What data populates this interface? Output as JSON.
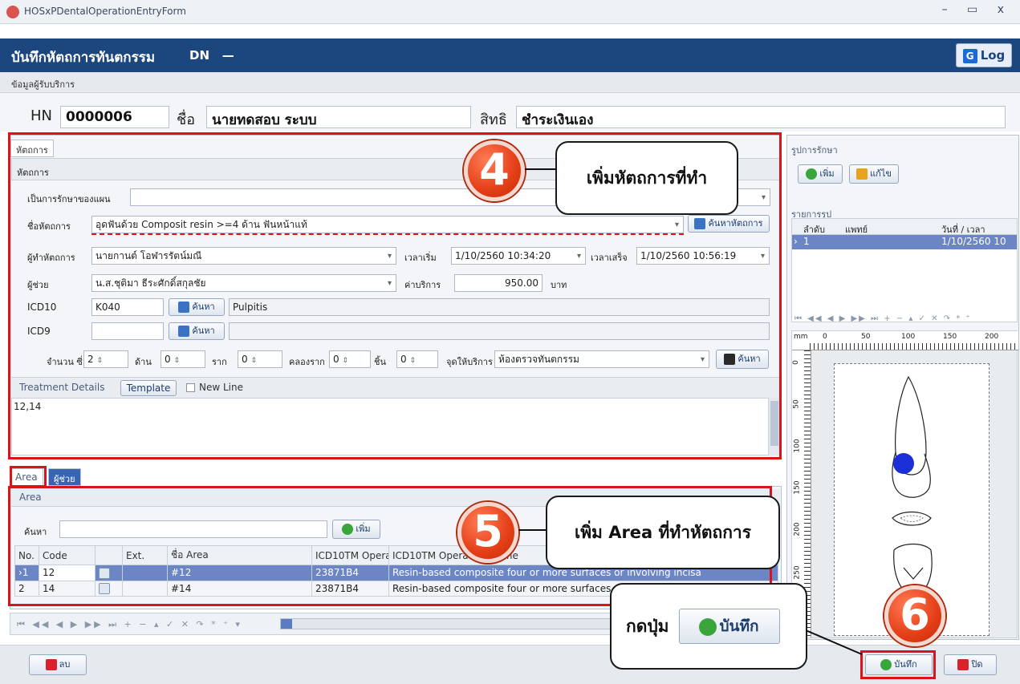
{
  "window": {
    "title": "HOSxPDentalOperationEntryForm",
    "controls": "–   ▭   x"
  },
  "header": {
    "title": "บันทึกหัตถการทันตกรรม",
    "dn": "DN",
    "dn_value": "—",
    "log_label": "Log",
    "log_icon": "log-icon"
  },
  "patient_section": {
    "label": "ข้อมูลผู้รับบริการ"
  },
  "patient": {
    "hn_label": "HN",
    "hn": "0000006",
    "name_label": "ชื่อ",
    "name": "นายทดสอบ ระบบ",
    "right_label": "สิทธิ",
    "right": "ชำระเงินเอง"
  },
  "procedure": {
    "tab": "หัตถการ",
    "group_label": "หัตถการ",
    "plan_label": "เป็นการรักษาของแผน",
    "plan_value": "",
    "name_label": "ชื่อหัตถการ",
    "name_value": "อุดฟันด้วย Composit resin >=4 ด้าน ฟันหน้าแท้",
    "search_proc_btn": "ค้นหาหัตถการ",
    "operator_label": "ผู้ทำหัตถการ",
    "operator_value": "นายกานต์ โอฬารรัตน์มณี",
    "start_label": "เวลาเริ่ม",
    "start_value": "1/10/2560 10:34:20",
    "end_label": "เวลาเสร็จ",
    "end_value": "1/10/2560 10:56:19",
    "assistant_label": "ผู้ช่วย",
    "assistant_value": "น.ส.ชุติมา ธีระศักดิ์สกุลชัย",
    "fee_label": "ค่าบริการ",
    "fee_value": "950.00",
    "fee_unit": "บาท",
    "icd10_label": "ICD10",
    "icd10_value": "K040",
    "icd10_desc": "Pulpitis",
    "search_btn": "ค้นหา",
    "icd9_label": "ICD9",
    "icd9_value": "",
    "icd9_desc": "",
    "count_label": "จำนวน ซี่",
    "count_value": "2",
    "side_label": "ด้าน",
    "side_value": "0",
    "root_label": "ราก",
    "root_value": "0",
    "canal_label": "คลองราก",
    "canal_value": "0",
    "piece_label": "ชิ้น",
    "piece_value": "0",
    "point_label": "จุดให้บริการ",
    "point_value": "ห้องตรวจทันตกรรม",
    "point_search_btn": "ค้นหา",
    "details_label": "Treatment Details",
    "template_btn": "Template",
    "newline_label": "New Line",
    "details_text": "12,14"
  },
  "area": {
    "tabs": [
      "Area",
      "ผู้ช่วย"
    ],
    "group_label": "Area",
    "search_label": "ค้นหา",
    "add_btn": "เพิ่ม",
    "columns": [
      "No.",
      "Code",
      "",
      "Ext.",
      "ชื่อ Area",
      "ICD10TM Operati",
      "ICD10TM Operation Name"
    ],
    "rows": [
      {
        "no": "1",
        "code": "12",
        "ext": "",
        "name": "#12",
        "icd": "23871B4",
        "op": "Resin-based composite  four or more surfaces or involving incisa"
      },
      {
        "no": "2",
        "code": "14",
        "ext": "",
        "name": "#14",
        "icd": "23871B4",
        "op": "Resin-based composite  four or more surfaces or involving incisa"
      }
    ],
    "nav": "⏮ ◀◀ ◀ ▶ ▶▶ ⏭ + − ▴ ✓ ✕ ↷ * ⁺ ▾"
  },
  "treatment_images": {
    "title": "รูปการรักษา",
    "add_btn": "เพิ่ม",
    "edit_btn": "แก้ไข",
    "list_title": "รายการรูป",
    "columns": [
      "ลำดับ",
      "แพทย์",
      "วันที่ / เวลา"
    ],
    "rows": [
      {
        "seq": "1",
        "doctor": "",
        "datetime": "1/10/2560 10"
      }
    ],
    "nav": "⏮ ◀◀ ◀ ▶ ▶▶ ⏭ + − ▴ ✓ ✕ ↷ * ⁺",
    "ruler_unit": "mm",
    "ruler_ticks": [
      "0",
      "50",
      "100",
      "150",
      "200"
    ],
    "ruler_v_ticks": [
      "0",
      "50",
      "100",
      "150",
      "200",
      "250"
    ]
  },
  "footer": {
    "delete_btn": "ลบ",
    "save_btn": "บันทึก",
    "close_btn": "ปิด"
  },
  "annotations": {
    "step4": "4",
    "step4_text": "เพิ่มหัตถการที่ทำ",
    "step5": "5",
    "step5_text": "เพิ่ม Area ที่ทำหัตถการ",
    "step6": "6",
    "step6_text": "กดปุ่ม",
    "step6_button": "บันทึก"
  },
  "colors": {
    "header_bg": "#1c467e",
    "highlight": "#d9151b",
    "selected_row": "#6c85c4",
    "badge": "#e43e17"
  }
}
